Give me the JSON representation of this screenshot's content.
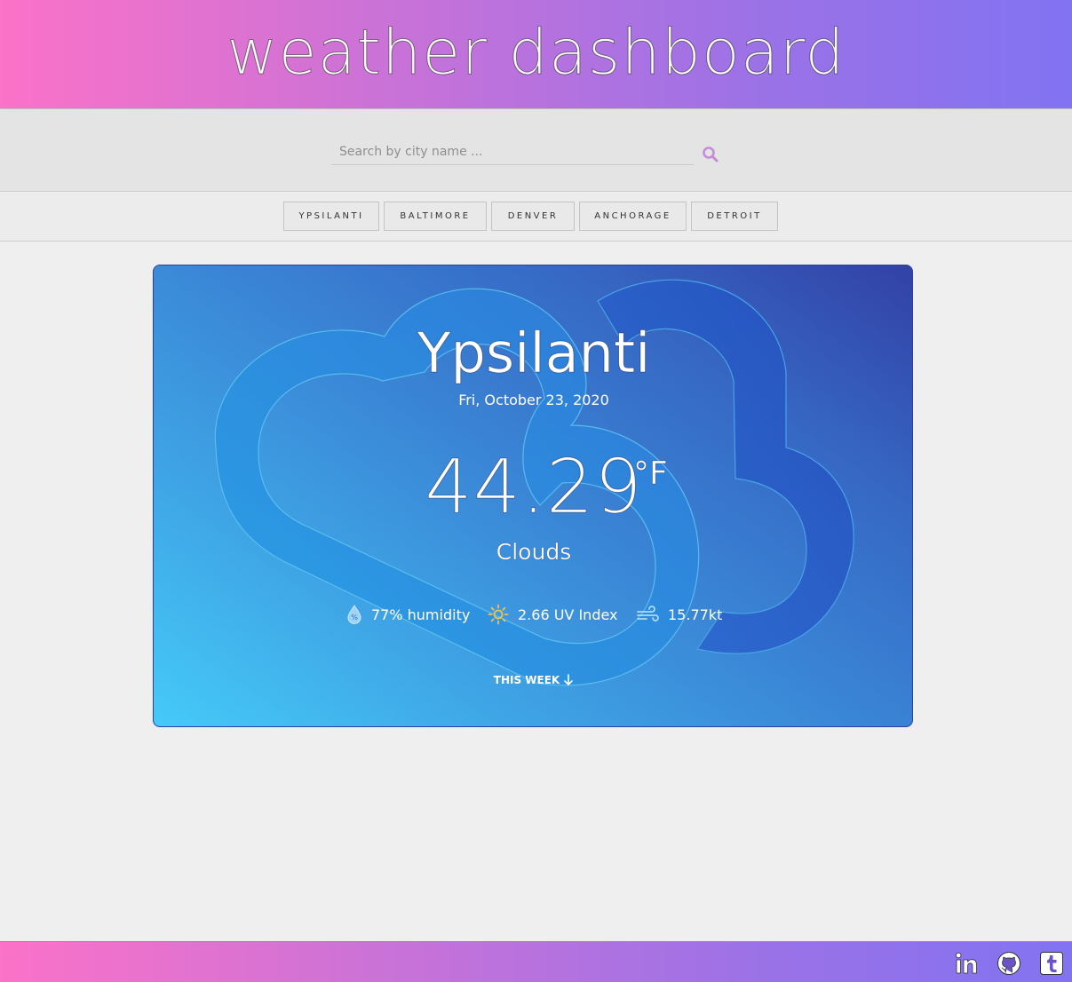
{
  "header": {
    "title": "weather dashboard"
  },
  "search": {
    "placeholder": "Search by city name ...",
    "value": "",
    "icon": "search-icon"
  },
  "cities": [
    "YPSILANTI",
    "BALTIMORE",
    "DENVER",
    "ANCHORAGE",
    "DETROIT"
  ],
  "weather": {
    "city": "Ypsilanti",
    "date": "Fri, October 23, 2020",
    "temperature": "44.29",
    "unit": "°F",
    "condition": "Clouds",
    "humidity": "77% humidity",
    "uv_index": "2.66 UV Index",
    "wind": "15.77kt",
    "this_week_label": "THIS WEEK"
  },
  "footer": {
    "icons": [
      "linkedin-icon",
      "github-icon",
      "tumblr-icon"
    ]
  },
  "colors": {
    "accent": "#c48cd8",
    "header_gradient_start": "#fb72c8",
    "header_gradient_end": "#8273f2",
    "card_gradient_start": "#45caf8",
    "card_gradient_end": "#3341a6"
  }
}
